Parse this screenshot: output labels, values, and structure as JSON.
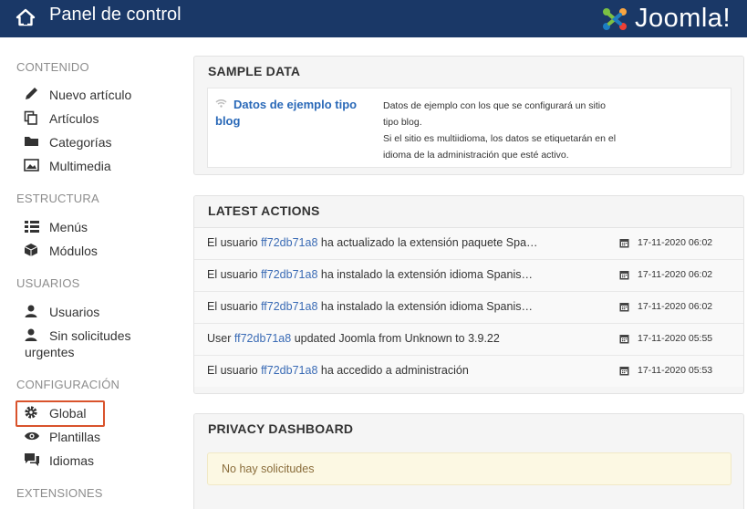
{
  "header": {
    "title": "Panel de control",
    "brand": "Joomla!"
  },
  "sidebar": {
    "sections": [
      {
        "title": "CONTENIDO"
      },
      {
        "title": "ESTRUCTURA"
      },
      {
        "title": "USUARIOS"
      },
      {
        "title": "CONFIGURACIÓN"
      },
      {
        "title": "EXTENSIONES"
      }
    ],
    "items": {
      "nuevo_articulo": "Nuevo artículo",
      "articulos": "Artículos",
      "categorias": "Categorías",
      "multimedia": "Multimedia",
      "menus": "Menús",
      "modulos": "Módulos",
      "usuarios": "Usuarios",
      "sin_solicitudes_1": "Sin solicitudes",
      "sin_solicitudes_2": "urgentes",
      "global": "Global",
      "plantillas": "Plantillas",
      "idiomas": "Idiomas"
    }
  },
  "sample_data": {
    "title": "SAMPLE DATA",
    "link_label": "Datos de ejemplo tipo blog",
    "desc_lines": [
      "Datos de ejemplo con los que se configurará un sitio",
      "tipo blog.",
      "Si el sitio es multiidioma, los datos se etiquetarán en el",
      "idioma de la administración que esté activo."
    ]
  },
  "latest_actions": {
    "title": "LATEST ACTIONS",
    "rows": [
      {
        "prefix": "El usuario ",
        "user": "ff72db71a8",
        "suffix": " ha actualizado la extensión paquete Spa…",
        "date": "17-11-2020 06:02"
      },
      {
        "prefix": "El usuario ",
        "user": "ff72db71a8",
        "suffix": " ha instalado la extensión idioma Spanis…",
        "date": "17-11-2020 06:02"
      },
      {
        "prefix": "El usuario ",
        "user": "ff72db71a8",
        "suffix": " ha instalado la extensión idioma Spanis…",
        "date": "17-11-2020 06:02"
      },
      {
        "prefix": "User ",
        "user": "ff72db71a8",
        "suffix": " updated Joomla from Unknown to 3.9.22",
        "date": "17-11-2020 05:55"
      },
      {
        "prefix": "El usuario ",
        "user": "ff72db71a8",
        "suffix": " ha accedido a administración",
        "date": "17-11-2020 05:53"
      }
    ]
  },
  "privacy": {
    "title": "PRIVACY DASHBOARD",
    "empty_message": "No hay solicitudes"
  },
  "colors": {
    "header_bg": "#1a3867",
    "link": "#2a69b8",
    "highlight_border": "#d9532c",
    "alert_bg": "#fcf8e3"
  }
}
